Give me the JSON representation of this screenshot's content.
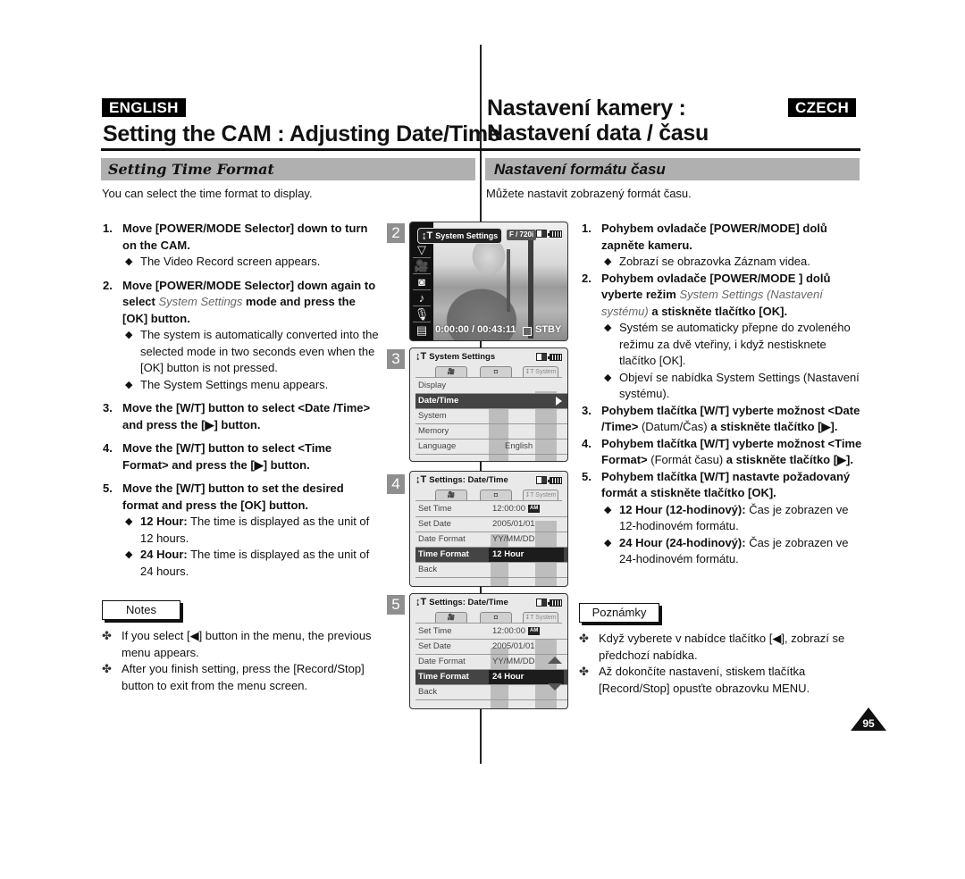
{
  "header": {
    "en_badge": "ENGLISH",
    "cz_badge": "CZECH",
    "en_title": "Setting the CAM : Adjusting Date/Time",
    "cz_title_line1": "Nastavení kamery :",
    "cz_title_line2": "Nastavení data / času"
  },
  "english": {
    "section_title": "Setting Time Format",
    "intro": "You can select the time format to display.",
    "steps": [
      {
        "num": "1.",
        "head": "Move [POWER/MODE Selector] down to turn on the CAM.",
        "subs": [
          "The Video Record screen appears."
        ]
      },
      {
        "num": "2.",
        "head_pre": "Move [POWER/MODE Selector] down again to select ",
        "head_em": "System Settings",
        "head_post": " mode and press the [OK] button.",
        "subs": [
          "The system is automatically converted into the selected mode in two seconds even when the [OK] button is not pressed.",
          "The System Settings menu appears."
        ]
      },
      {
        "num": "3.",
        "head": "Move the [W/T] button to select <Date /Time> and press the [▶] button."
      },
      {
        "num": "4.",
        "head": "Move the [W/T] button to select <Time Format> and press the [▶] button."
      },
      {
        "num": "5.",
        "head": "Move the [W/T] button to set the desired format and press the [OK] button.",
        "subs_rich": [
          {
            "bold": "12 Hour:",
            "text": " The time is displayed as the unit of 12 hours."
          },
          {
            "bold": "24 Hour:",
            "text": " The time is displayed as the unit of 24 hours."
          }
        ]
      }
    ],
    "notes_label": "Notes",
    "notes": [
      "If you select [◀] button in the menu, the previous menu appears.",
      "After you finish setting, press the [Record/Stop] button to exit from the menu screen."
    ]
  },
  "czech": {
    "section_title": "Nastavení formátu času",
    "intro": "Můžete nastavit zobrazený formát času.",
    "steps": [
      {
        "num": "1.",
        "head": "Pohybem ovladače [POWER/MODE] dolů zapněte kameru.",
        "subs": [
          "Zobrazí se obrazovka Záznam videa."
        ]
      },
      {
        "num": "2.",
        "head_pre": "Pohybem ovladače [POWER/MODE ] dolů vyberte režim ",
        "head_em": "System Settings (Nastavení systému)",
        "head_post": " a stiskněte tlačítko [OK].",
        "subs": [
          "Systém se automaticky přepne do zvoleného režimu za dvě vteřiny, i když nestisknete tlačítko [OK].",
          "Objeví se nabídka System Settings (Nastavení systému)."
        ]
      },
      {
        "num": "3.",
        "head_pre": "Pohybem tlačítka [W/T] vyberte možnost <Date /Time> ",
        "head_plain": "(Datum/Čas)",
        "head_post": " a stiskněte tlačítko [▶]."
      },
      {
        "num": "4.",
        "head_pre": "Pohybem tlačítka [W/T] vyberte možnost <Time Format> ",
        "head_plain": "(Formát času)",
        "head_post": " a stiskněte tlačítko [▶]."
      },
      {
        "num": "5.",
        "head": "Pohybem tlačítka [W/T] nastavte požadovaný formát a stiskněte tlačítko [OK].",
        "subs_rich": [
          {
            "bold": "12 Hour (12-hodinový):",
            "text": " Čas je zobrazen ve 12-hodinovém formátu."
          },
          {
            "bold": "24 Hour (24-hodinový):",
            "text": " Čas je zobrazen ve 24-hodinovém formátu."
          }
        ]
      }
    ],
    "notes_label": "Poznámky",
    "notes": [
      "Když vyberete v nabídce tlačítko [◀], zobrazí se předchozí nabídka.",
      "Až dokončíte nastavení, stiskem tlačítka [Record/Stop] opusťte obrazovku MENU."
    ]
  },
  "screens": {
    "s2": {
      "num": "2",
      "mode_label": "System Settings",
      "resolution": "F / 720i",
      "timecode": "0:00:00 / 00:43:11",
      "status": "STBY",
      "side_icons": [
        "chevron-down",
        "camcorder",
        "camera",
        "music",
        "microphone",
        "document"
      ]
    },
    "s3": {
      "num": "3",
      "title": "System Settings",
      "tabs": [
        "🎥",
        "◘",
        "↧T System"
      ],
      "rows": [
        {
          "label": "Display",
          "value": ""
        },
        {
          "label": "Date/Time",
          "value": "",
          "selected": true
        },
        {
          "label": "System",
          "value": ""
        },
        {
          "label": "Memory",
          "value": ""
        },
        {
          "label": "Language",
          "value": "English"
        }
      ]
    },
    "s4": {
      "num": "4",
      "title": "Settings: Date/Time",
      "tabs": [
        "🎥",
        "◘",
        "↧T System"
      ],
      "rows": [
        {
          "label": "Set Time",
          "value": "12:00:00",
          "badge": "AM"
        },
        {
          "label": "Set Date",
          "value": "2005/01/01"
        },
        {
          "label": "Date Format",
          "value": "YY/MM/DD"
        },
        {
          "label": "Time Format",
          "value": "12 Hour",
          "selected": true
        },
        {
          "label": "Back",
          "value": ""
        }
      ]
    },
    "s5": {
      "num": "5",
      "title": "Settings: Date/Time",
      "tabs": [
        "🎥",
        "◘",
        "↧T System"
      ],
      "rows": [
        {
          "label": "Set Time",
          "value": "12:00:00",
          "badge": "AM"
        },
        {
          "label": "Set Date",
          "value": "2005/01/01"
        },
        {
          "label": "Date Format",
          "value": "YY/MM/DD"
        },
        {
          "label": "Time Format",
          "value": "24 Hour",
          "selected": true
        },
        {
          "label": "Back",
          "value": ""
        }
      ]
    }
  },
  "page_number": "95"
}
